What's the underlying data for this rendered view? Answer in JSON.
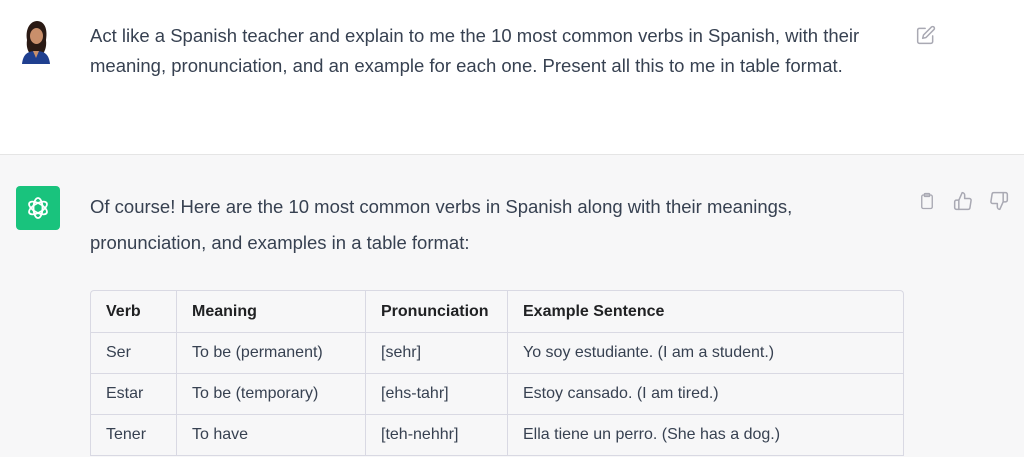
{
  "user_message": {
    "text": "Act like a Spanish teacher and explain to me the 10 most common verbs in Spanish, with their meaning, pronunciation, and an example for each one. Present all this to me in table format."
  },
  "assistant_message": {
    "intro": "Of course! Here are the 10 most common verbs in Spanish along with their meanings, pronunciation, and examples in a table format:"
  },
  "table": {
    "headers": [
      "Verb",
      "Meaning",
      "Pronunciation",
      "Example Sentence"
    ],
    "rows": [
      [
        "Ser",
        "To be (permanent)",
        "[sehr]",
        "Yo soy estudiante. (I am a student.)"
      ],
      [
        "Estar",
        "To be (temporary)",
        "[ehs-tahr]",
        "Estoy cansado. (I am tired.)"
      ],
      [
        "Tener",
        "To have",
        "[teh-nehhr]",
        "Ella tiene un perro. (She has a dog.)"
      ]
    ]
  },
  "icons": {
    "edit": "edit-icon",
    "copy": "clipboard-icon",
    "like": "thumbs-up-icon",
    "dislike": "thumbs-down-icon",
    "bot": "openai-logo-icon"
  },
  "colors": {
    "bot_avatar": "#19c37d",
    "user_bg": "#ffffff",
    "assistant_bg": "#f7f7f8"
  }
}
